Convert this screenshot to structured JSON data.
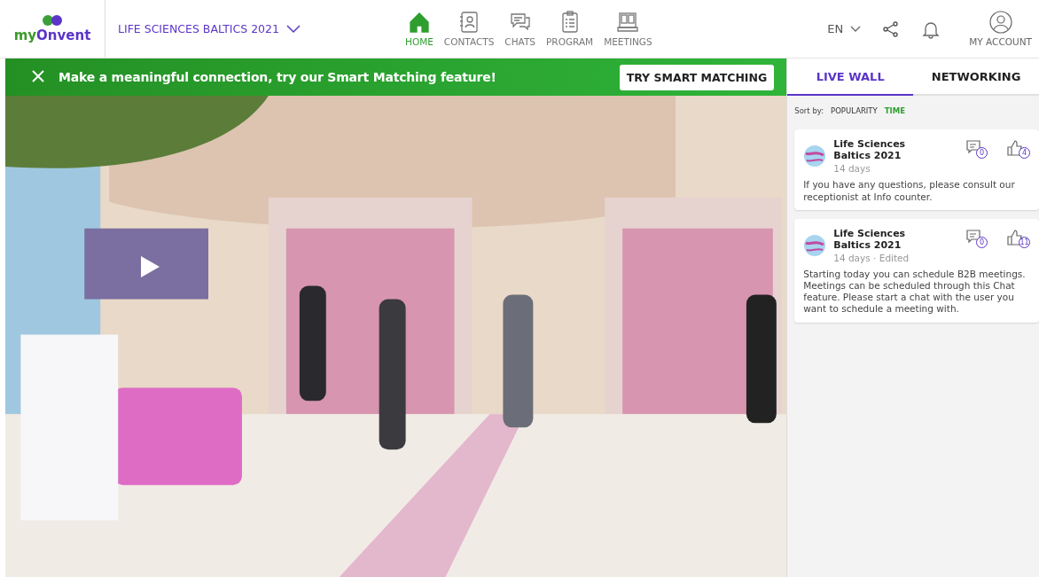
{
  "logo": {
    "prefix": "my",
    "name": "Onvent"
  },
  "event": {
    "title": "LIFE SCIENCES BALTICS 2021"
  },
  "nav": [
    {
      "label": "HOME",
      "kind": "home",
      "selected": true
    },
    {
      "label": "CONTACTS",
      "kind": "contacts",
      "selected": false
    },
    {
      "label": "CHATS",
      "kind": "chats",
      "selected": false
    },
    {
      "label": "PROGRAM",
      "kind": "program",
      "selected": false
    },
    {
      "label": "MEETINGS",
      "kind": "meetings",
      "selected": false
    }
  ],
  "language": "EN",
  "account": {
    "label": "MY ACCOUNT"
  },
  "banner": {
    "text": "Make a meaningful connection, try our Smart Matching feature!",
    "button": "TRY SMART MATCHING"
  },
  "tabs": [
    {
      "label": "LIVE WALL",
      "selected": true
    },
    {
      "label": "NETWORKING",
      "selected": false
    }
  ],
  "sort": {
    "label": "Sort by:",
    "options": [
      {
        "label": "POPULARITY",
        "selected": false
      },
      {
        "label": "TIME",
        "selected": true
      }
    ]
  },
  "posts": [
    {
      "author": "Life Sciences Baltics 2021",
      "time": "14 days",
      "comments": "0",
      "likes": "4",
      "text": "If you have any questions, please consult our receptionist at Info counter."
    },
    {
      "author": "Life Sciences Baltics 2021",
      "time": "14 days · Edited",
      "comments": "0",
      "likes": "11",
      "text": "Starting today you can schedule B2B meetings. Meetings can be scheduled through this Chat feature. Please start a chat with the user you want to schedule a meeting with."
    }
  ]
}
